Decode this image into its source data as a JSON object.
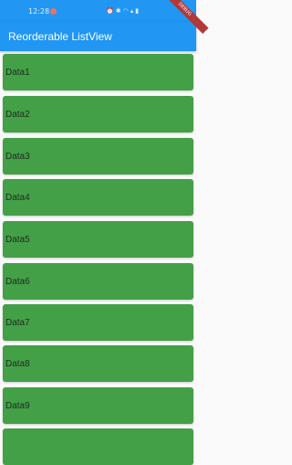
{
  "status_bar": {
    "time": "12:28",
    "icons": [
      "alarm-icon",
      "bluetooth-icon",
      "wifi-icon",
      "signal-icon",
      "battery-icon"
    ]
  },
  "app_bar": {
    "title": "Reorderable ListView",
    "debug_banner": "DEBUG"
  },
  "list": {
    "items": [
      {
        "label": "Data1"
      },
      {
        "label": "Data2"
      },
      {
        "label": "Data3"
      },
      {
        "label": "Data4"
      },
      {
        "label": "Data5"
      },
      {
        "label": "Data6"
      },
      {
        "label": "Data7"
      },
      {
        "label": "Data8"
      },
      {
        "label": "Data9"
      },
      {
        "label": ""
      }
    ]
  },
  "colors": {
    "app_bar": "#2196f3",
    "item_background": "#43a047",
    "page_background": "#fafafa"
  }
}
